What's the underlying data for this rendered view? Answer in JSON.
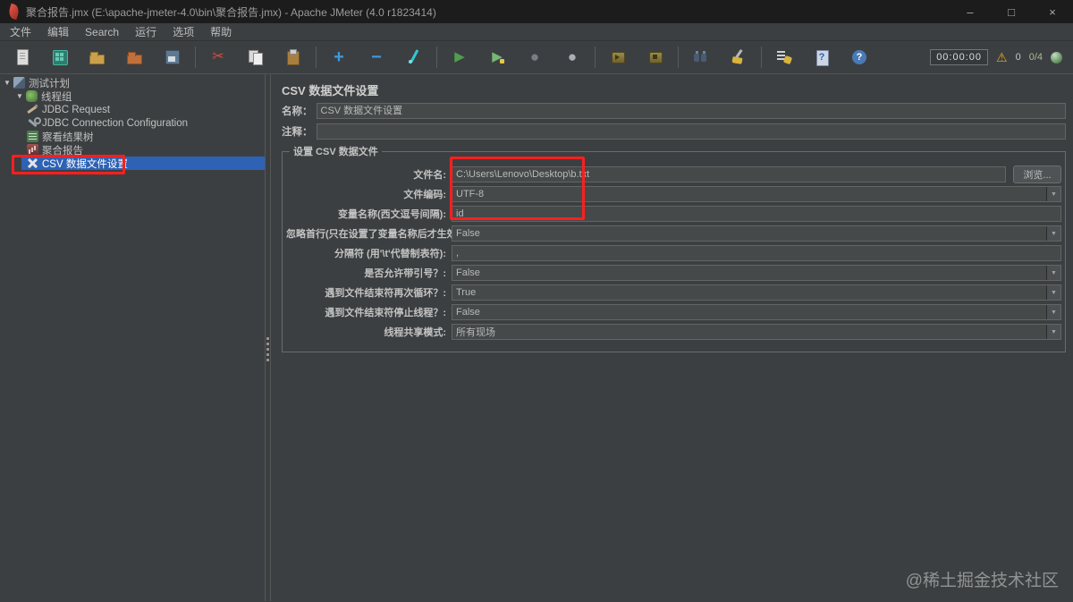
{
  "window": {
    "title": "聚合报告.jmx (E:\\apache-jmeter-4.0\\bin\\聚合报告.jmx) - Apache JMeter (4.0 r1823414)",
    "controls": {
      "minimize": "–",
      "maximize": "□",
      "close": "×"
    }
  },
  "menubar": {
    "items": [
      "文件",
      "编辑",
      "Search",
      "运行",
      "选项",
      "帮助"
    ]
  },
  "toolbar": {
    "icons": [
      "new-file-icon",
      "templates-icon",
      "open-file-icon",
      "close-file-icon",
      "save-icon",
      "cut-icon",
      "copy-icon",
      "paste-icon",
      "add-icon",
      "remove-icon",
      "toggle-icon",
      "start-icon",
      "start-no-timers-icon",
      "stop-icon",
      "shutdown-icon",
      "remote-start-all-icon",
      "remote-shutdown-all-icon",
      "search-icon",
      "clear-icon",
      "clear-all-icon",
      "function-helper-icon",
      "help-icon"
    ],
    "timer": "00:00:00",
    "warning_count": "0",
    "active_threads": "0/4"
  },
  "icons": {
    "expander": "▼",
    "dropdown_arrow": "▼",
    "warning": "⚠"
  },
  "tree": {
    "items": [
      {
        "label": "测试计划",
        "icon": "test-plan-icon"
      },
      {
        "label": "线程组",
        "icon": "thread-group-icon"
      },
      {
        "label": "JDBC Request",
        "icon": "jdbc-request-icon"
      },
      {
        "label": "JDBC Connection Configuration",
        "icon": "jdbc-connection-config-icon"
      },
      {
        "label": "察看结果树",
        "icon": "view-results-tree-icon"
      },
      {
        "label": "聚合报告",
        "icon": "aggregate-report-icon"
      },
      {
        "label": "CSV 数据文件设置",
        "icon": "csv-data-set-icon",
        "selected": true
      }
    ]
  },
  "main": {
    "title": "CSV 数据文件设置",
    "name_label": "名称：",
    "name_value": "CSV 数据文件设置",
    "comment_label": "注释：",
    "comment_value": "",
    "group_title": "设置 CSV 数据文件",
    "browse_label": "浏览...",
    "fields": [
      {
        "label": "文件名:",
        "value": "C:\\Users\\Lenovo\\Desktop\\b.txt",
        "type": "file"
      },
      {
        "label": "文件编码:",
        "value": "UTF-8",
        "type": "combo"
      },
      {
        "label": "变量名称(西文逗号间隔):",
        "value": "id",
        "type": "text"
      },
      {
        "label": "忽略首行(只在设置了变量名称后才生效):",
        "value": "False",
        "type": "combo"
      },
      {
        "label": "分隔符 (用'\\t'代替制表符):",
        "value": ",",
        "type": "text"
      },
      {
        "label": "是否允许带引号？:",
        "value": "False",
        "type": "combo"
      },
      {
        "label": "遇到文件结束符再次循环？:",
        "value": "True",
        "type": "combo"
      },
      {
        "label": "遇到文件结束符停止线程？:",
        "value": "False",
        "type": "combo"
      },
      {
        "label": "线程共享模式:",
        "value": "所有现场",
        "type": "combo"
      }
    ]
  },
  "watermark": "@稀土掘金技术社区"
}
